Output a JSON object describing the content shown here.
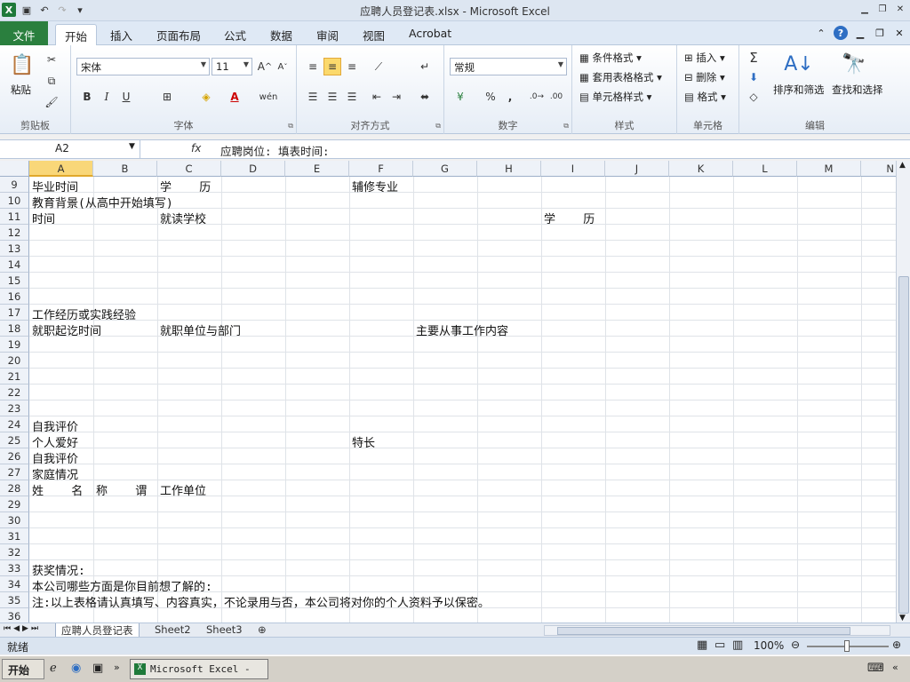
{
  "window": {
    "title": "应聘人员登记表.xlsx - Microsoft Excel"
  },
  "ribbon_tabs": [
    "文件",
    "开始",
    "插入",
    "页面布局",
    "公式",
    "数据",
    "审阅",
    "视图",
    "Acrobat"
  ],
  "clipboard": {
    "paste": "粘贴",
    "label": "剪贴板"
  },
  "font": {
    "name": "宋体",
    "size": "11",
    "label": "字体",
    "bold": "B",
    "italic": "I",
    "underline": "U"
  },
  "alignment": {
    "label": "对齐方式"
  },
  "number": {
    "format": "常规",
    "label": "数字",
    "percent": "%",
    "comma": ","
  },
  "styles": {
    "conditional": "条件格式",
    "table": "套用表格格式",
    "cell": "单元格样式",
    "label": "样式"
  },
  "cells": {
    "insert": "插入",
    "delete": "删除",
    "format": "格式",
    "label": "单元格"
  },
  "editing": {
    "sort": "排序和筛选",
    "find": "查找和选择",
    "label": "编辑"
  },
  "formula_bar": {
    "name_box": "A2",
    "fx": "fx",
    "content": "应聘岗位:                          填表时间:"
  },
  "columns": [
    "A",
    "B",
    "C",
    "D",
    "E",
    "F",
    "G",
    "H",
    "I",
    "J",
    "K",
    "L",
    "M",
    "N"
  ],
  "rows": [
    "9",
    "10",
    "11",
    "12",
    "13",
    "14",
    "15",
    "16",
    "17",
    "18",
    "19",
    "20",
    "21",
    "22",
    "23",
    "24",
    "25",
    "26",
    "27",
    "28",
    "29",
    "30",
    "31",
    "32",
    "33",
    "34",
    "35",
    "36"
  ],
  "cell_text": {
    "r9a": "毕业时间",
    "r9c": "学    历",
    "r9f": "辅修专业",
    "r10a": "教育背景(从高中开始填写)",
    "r11a": "时间",
    "r11c": "就读学校",
    "r11i": "学    历",
    "r17a": "工作经历或实践经验",
    "r18a": "就职起讫时间",
    "r18c": "就职单位与部门",
    "r18g": "主要从事工作内容",
    "r24a": "自我评价",
    "r25a": "个人爱好",
    "r25f": "特长",
    "r26a": "自我评价",
    "r27a": "家庭情况",
    "r28a": "姓    名",
    "r28b": "称    谓",
    "r28c": "工作单位",
    "r33a": "获奖情况:",
    "r34a": "本公司哪些方面是你目前想了解的:",
    "r35a": "注:以上表格请认真填写、内容真实，不论录用与否，本公司将对你的个人资料予以保密。"
  },
  "sheets": [
    "应聘人员登记表",
    "Sheet2",
    "Sheet3"
  ],
  "status": {
    "ready": "就绪",
    "zoom": "100%"
  },
  "taskbar": {
    "start": "开始",
    "app": "Microsoft Excel - ..."
  }
}
